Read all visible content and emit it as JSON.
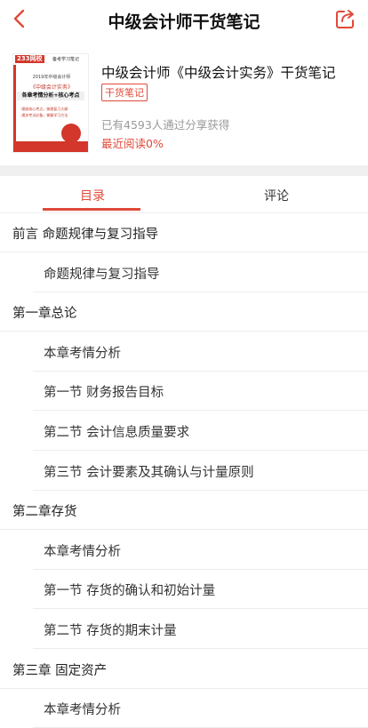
{
  "header": {
    "title": "中级会计师干货笔记",
    "back_icon": "chevron-left-icon",
    "share_icon": "share-icon",
    "accent_color": "#e04a3a"
  },
  "book": {
    "title": "中级会计师《中级会计实务》干货笔记",
    "tag": "干货笔记",
    "share_info": "已有4593人通过分享获得",
    "progress": "最近阅读0%",
    "cover": {
      "logo": "233网校",
      "header_text": "备考学习笔记",
      "line1": "2019年中级会计师",
      "line2": "《中级会计实务》",
      "band": "各章考情分析+核心考点",
      "bullets": [
        "·理顺核心考点，梳理复习大纲",
        "·通关考试必备，掌握学习方法"
      ]
    }
  },
  "tabs": {
    "toc": "目录",
    "comment": "评论",
    "active": "toc"
  },
  "toc": [
    {
      "text": "前言 命题规律与复习指导",
      "level": "chapter"
    },
    {
      "text": "命题规律与复习指导",
      "level": "section"
    },
    {
      "text": "第一章总论",
      "level": "chapter"
    },
    {
      "text": "本章考情分析",
      "level": "section"
    },
    {
      "text": "第一节 财务报告目标",
      "level": "section"
    },
    {
      "text": "第二节 会计信息质量要求",
      "level": "section"
    },
    {
      "text": "第三节 会计要素及其确认与计量原则",
      "level": "section"
    },
    {
      "text": "第二章存货",
      "level": "chapter"
    },
    {
      "text": "本章考情分析",
      "level": "section"
    },
    {
      "text": "第一节 存货的确认和初始计量",
      "level": "section"
    },
    {
      "text": "第二节 存货的期末计量",
      "level": "section"
    },
    {
      "text": "第三章 固定资产",
      "level": "chapter"
    },
    {
      "text": "本章考情分析",
      "level": "section"
    }
  ]
}
